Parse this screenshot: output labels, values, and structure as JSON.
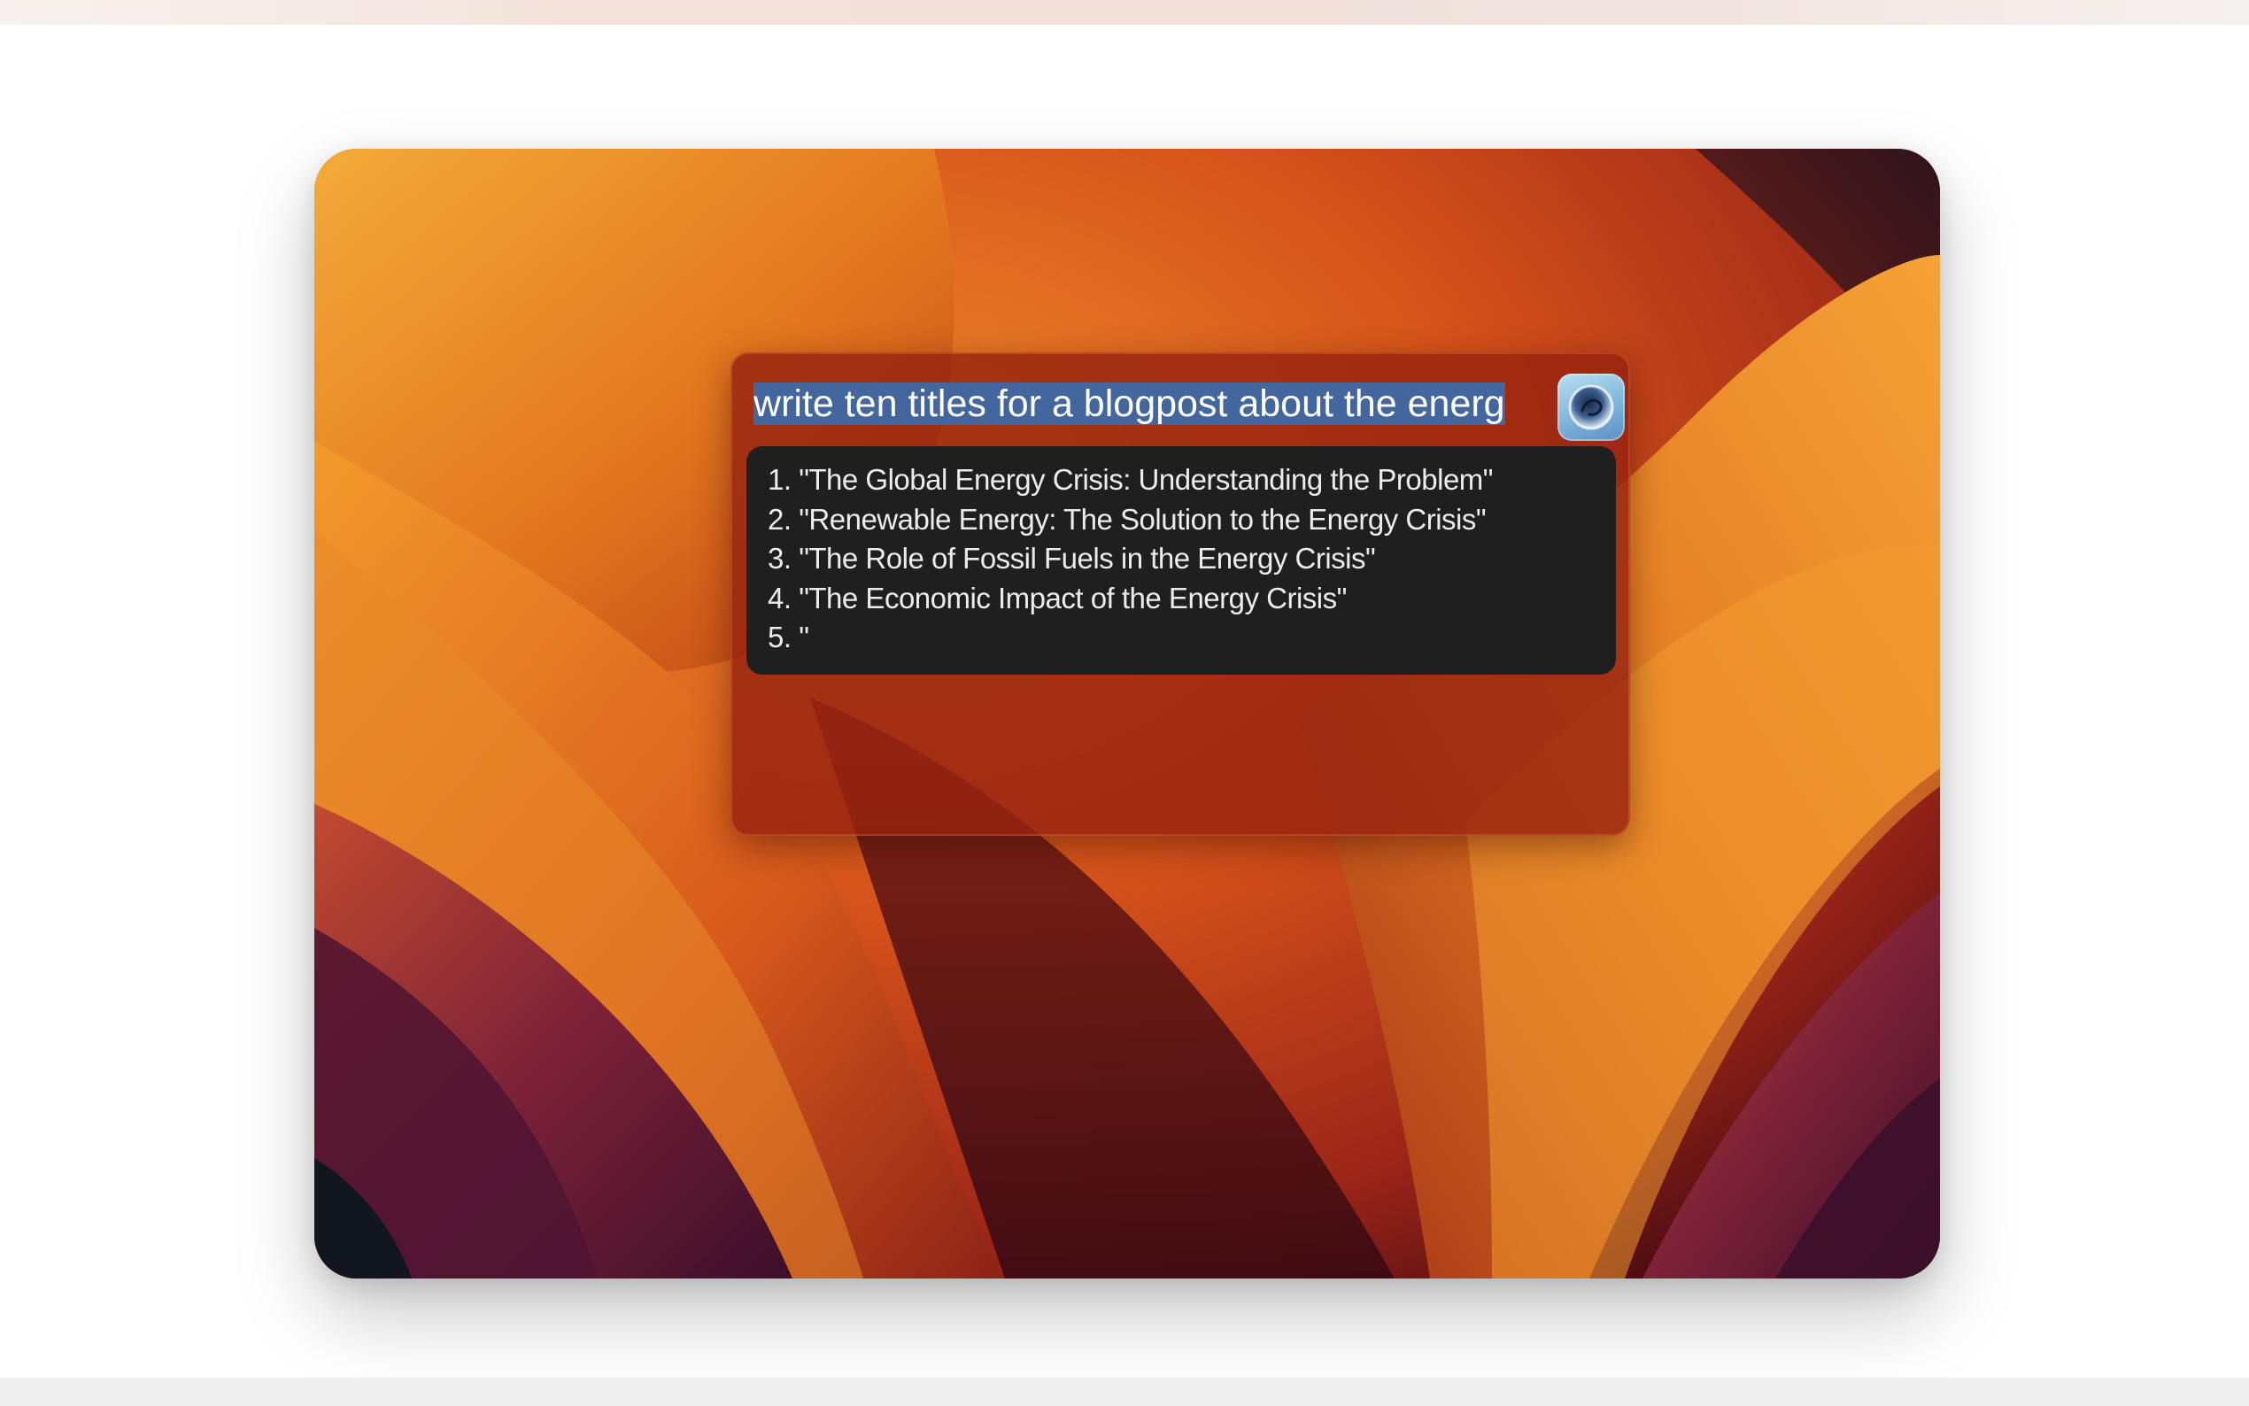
{
  "prompt": {
    "input_value": "write ten titles for a blogpost about the energ"
  },
  "assistant_button": {
    "icon": "ai-assistant-icon"
  },
  "response": {
    "lines": [
      "1. \"The Global Energy Crisis: Understanding the Problem\"",
      "2. \"Renewable Energy: The Solution to the Energy Crisis\"",
      "3. \"The Role of Fossil Fuels in the Energy Crisis\"",
      "4. \"The Economic Impact of the Energy Crisis\"",
      "5. \""
    ]
  },
  "colors": {
    "selection_highlight": "#44669e",
    "panel_background": "#962210",
    "response_background": "#1f1f1f",
    "response_text": "#ececec"
  }
}
